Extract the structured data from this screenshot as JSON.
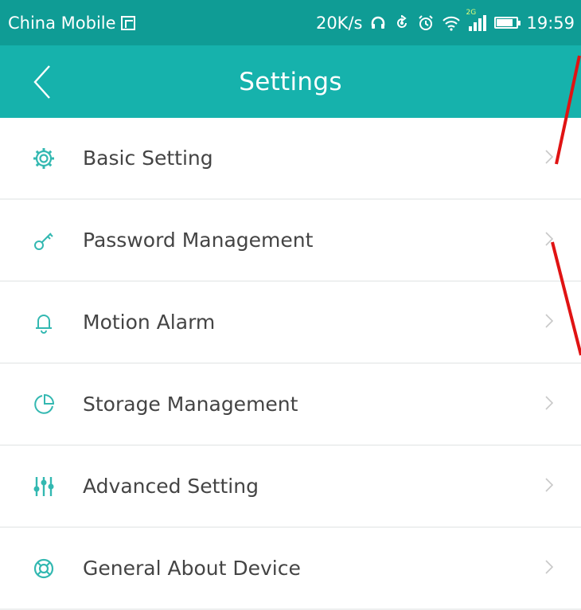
{
  "status_bar": {
    "carrier": "China Mobile",
    "net_speed": "20K/s",
    "network_type": "2G",
    "time": "19:59"
  },
  "header": {
    "title": "Settings"
  },
  "menu": {
    "items": [
      {
        "label": "Basic Setting",
        "icon": "gear-icon"
      },
      {
        "label": "Password Management",
        "icon": "key-icon"
      },
      {
        "label": "Motion Alarm",
        "icon": "bell-icon"
      },
      {
        "label": "Storage Management",
        "icon": "storage-icon"
      },
      {
        "label": "Advanced Setting",
        "icon": "sliders-icon"
      },
      {
        "label": "General About Device",
        "icon": "lifebuoy-icon"
      }
    ]
  },
  "colors": {
    "status_bar": "#0f9c95",
    "app_bar": "#16b2ac",
    "icon": "#33b8b1",
    "chevron": "#c8c8c8",
    "annotation": "#e01313"
  }
}
